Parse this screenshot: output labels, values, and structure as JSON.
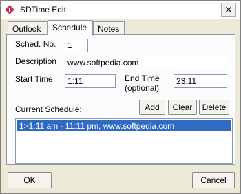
{
  "window": {
    "title": "SDTime Edit"
  },
  "tabs": [
    {
      "label": "Outlook"
    },
    {
      "label": "Schedule"
    },
    {
      "label": "Notes"
    }
  ],
  "form": {
    "sched_no_label": "Sched. No.",
    "sched_no_value": "1",
    "description_label": "Description",
    "description_value": "www.softpedia.com",
    "start_time_label": "Start Time",
    "start_time_value": "1:11",
    "end_time_label_line1": "End Time",
    "end_time_label_line2": "(optional)",
    "end_time_value": "23:11"
  },
  "schedule": {
    "label": "Current Schedule:",
    "add_label": "Add",
    "clear_label": "Clear",
    "delete_label": "Delete",
    "items": [
      {
        "text": "1>1:11 am - 11:11 pm, www.softpedia.com"
      }
    ]
  },
  "buttons": {
    "ok_label": "OK",
    "cancel_label": "Cancel"
  },
  "colors": {
    "selection": "#316ac5",
    "dialog_bg": "#ece9d8"
  }
}
